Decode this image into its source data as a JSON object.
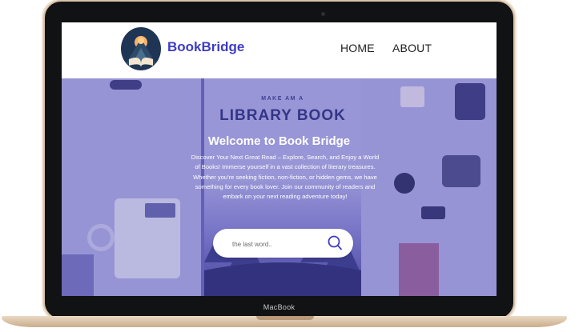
{
  "device": {
    "label": "MacBook"
  },
  "navbar": {
    "site_name": "BookBridge",
    "links": [
      {
        "label": "HOME"
      },
      {
        "label": "ABOUT"
      }
    ]
  },
  "hero": {
    "book_sub": "MAKE AM A",
    "book_title": "LIBRARY BOOK",
    "title": "Welcome to Book Bridge",
    "description": "Discover Your Next Great Read – Explore, Search, and Enjoy a World of Books! Immerse yourself in a vast collection of literary treasures. Whether you're seeking fiction, non-fiction, or hidden gems, we have something for every book lover. Join our community of readers and embark on your next reading adventure today!"
  },
  "search": {
    "placeholder": "the last word..",
    "icon": "search-icon"
  },
  "colors": {
    "brand": "#3d3cc4",
    "overlay": "#6f6dc0",
    "frame": "#111214",
    "base": "#ead9c3"
  }
}
